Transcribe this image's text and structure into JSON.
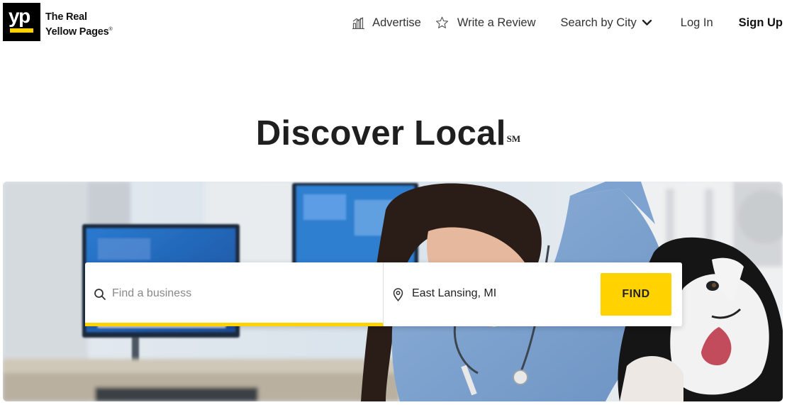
{
  "logo": {
    "mark": "yp",
    "line1": "The Real",
    "line2": "Yellow Pages",
    "trademark": "®"
  },
  "nav": {
    "advertise": "Advertise",
    "write_review": "Write a Review",
    "search_by_city": "Search by City",
    "log_in": "Log In",
    "sign_up": "Sign Up"
  },
  "hero": {
    "title": "Discover Local",
    "service_mark": "SM"
  },
  "search": {
    "what_placeholder": "Find a business",
    "where_value": "East Lansing, MI",
    "find_label": "FIND"
  },
  "icons": {
    "advertise": "bar-chart-icon",
    "review": "star-outline-icon",
    "city": "chevron-down-icon",
    "search": "search-icon",
    "location": "map-pin-icon"
  },
  "colors": {
    "brand_yellow": "#ffd200",
    "logo_black": "#000000",
    "text_dark": "#1f1f1f"
  }
}
